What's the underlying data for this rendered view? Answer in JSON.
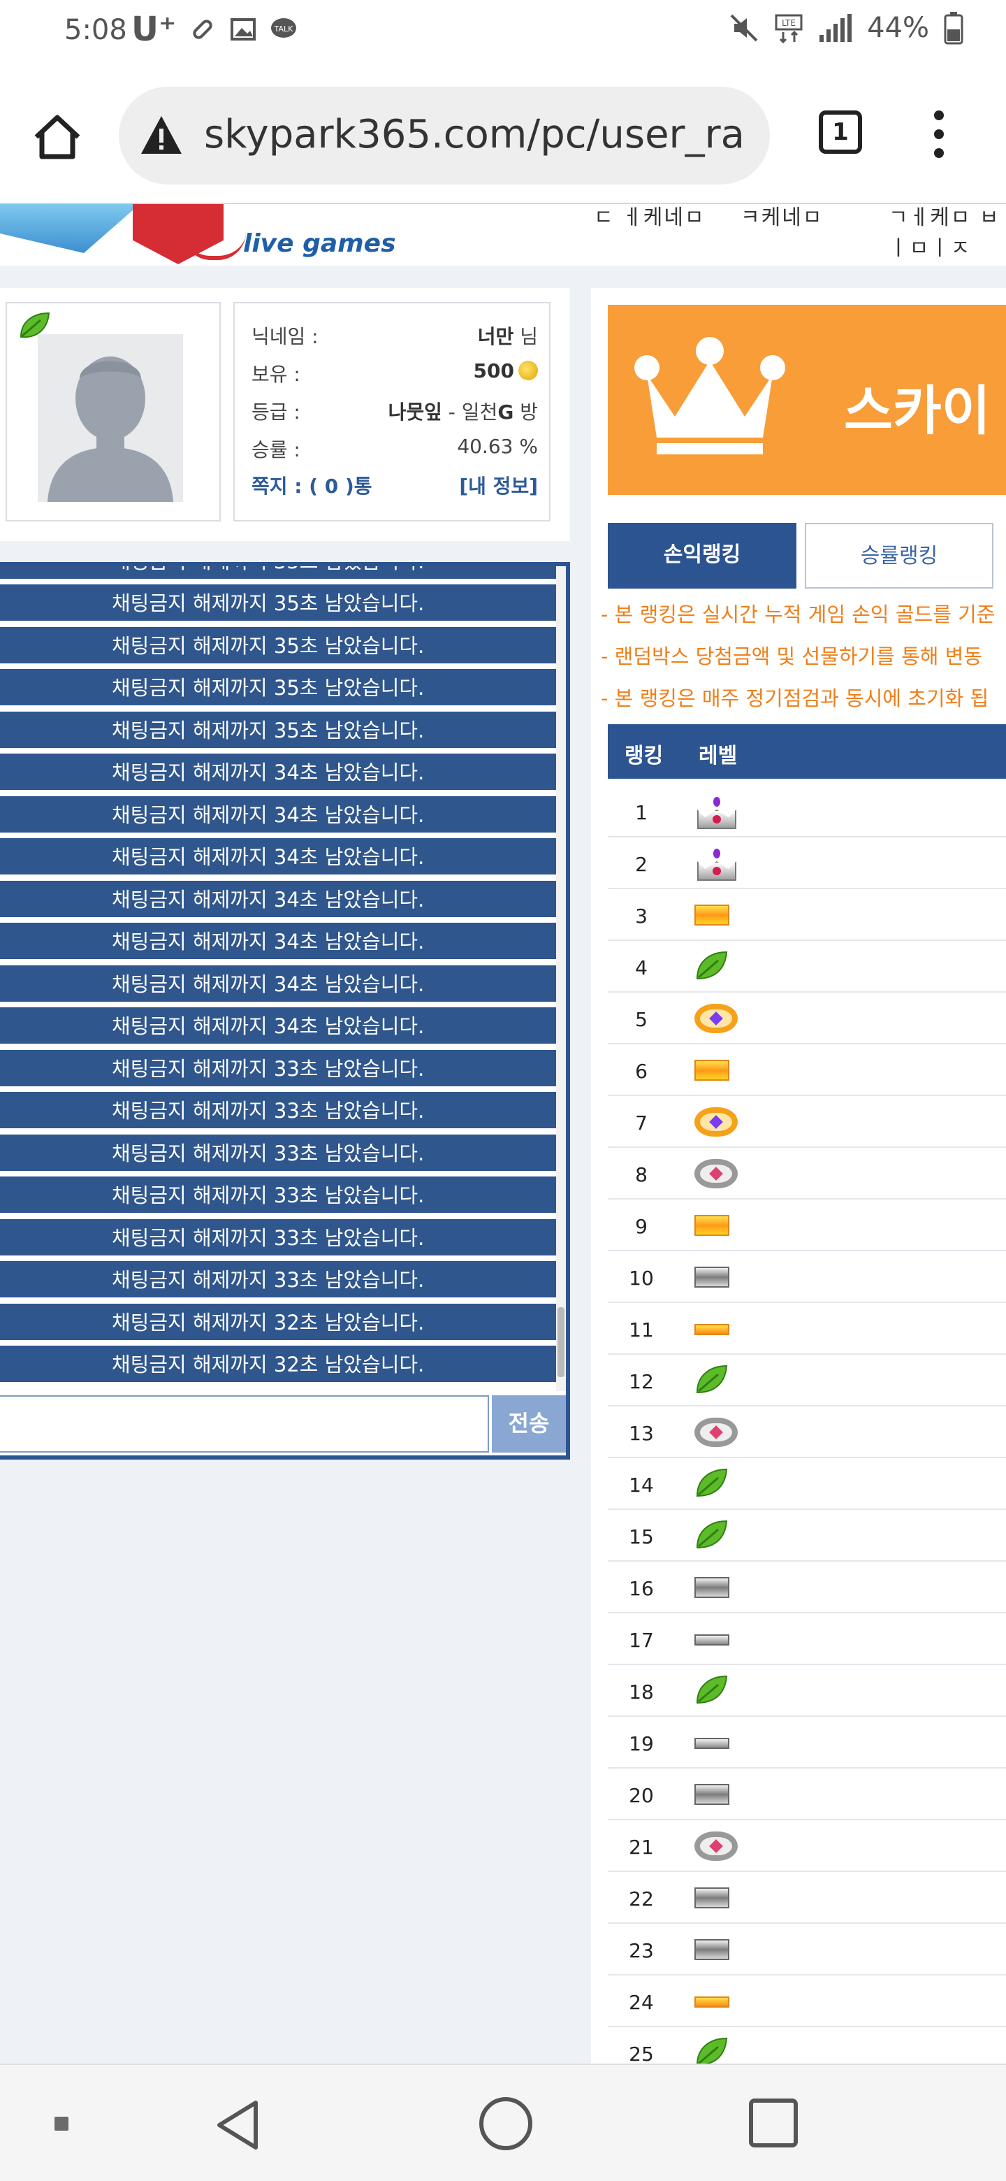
{
  "status_bar": {
    "time": "5:08",
    "carrier": "U⁺",
    "battery_pct": "44%",
    "icons": [
      "pill-icon",
      "image-icon",
      "talk-icon",
      "mute-icon",
      "lte-icon",
      "signal-icon",
      "battery-icon"
    ]
  },
  "browser": {
    "url": "skypark365.com/pc/user_ra",
    "tab_count": "1"
  },
  "header": {
    "logo_text": "live games",
    "nav_fragments": [
      "ㄷ ㅔ케네ㅁ",
      "ㅋ케네ㅁ",
      "ㄱㅔ케ㅁ ㅂㅣㅁㅣㅈ"
    ]
  },
  "user": {
    "nickname_label": "닉네임 :",
    "nickname_value": "너만",
    "nickname_suffix": "님",
    "holding_label": "보유 :",
    "holding_value": "500",
    "grade_label": "등급 :",
    "grade_value": "나뭇잎",
    "grade_extra_pre": " - 일천",
    "grade_extra_g": "G",
    "grade_extra_post": " 방",
    "winrate_label": "승률 :",
    "winrate_value": "40.63 %",
    "message_label": "쪽지 : ( 0 )통",
    "myinfo_label": "[내 정보]"
  },
  "chat": {
    "partial_message": "채팅금지 해제까지 35초 남았습니다.",
    "messages": [
      "채팅금지 해제까지 35초 남았습니다.",
      "채팅금지 해제까지 35초 남았습니다.",
      "채팅금지 해제까지 35초 남았습니다.",
      "채팅금지 해제까지 35초 남았습니다.",
      "채팅금지 해제까지 34초 남았습니다.",
      "채팅금지 해제까지 34초 남았습니다.",
      "채팅금지 해제까지 34초 남았습니다.",
      "채팅금지 해제까지 34초 남았습니다.",
      "채팅금지 해제까지 34초 남았습니다.",
      "채팅금지 해제까지 34초 남았습니다.",
      "채팅금지 해제까지 34초 남았습니다.",
      "채팅금지 해제까지 33초 남았습니다.",
      "채팅금지 해제까지 33초 남았습니다.",
      "채팅금지 해제까지 33초 남았습니다.",
      "채팅금지 해제까지 33초 남았습니다.",
      "채팅금지 해제까지 33초 남았습니다.",
      "채팅금지 해제까지 33초 남았습니다.",
      "채팅금지 해제까지 32초 남았습니다.",
      "채팅금지 해제까지 32초 남았습니다."
    ],
    "send_label": "전송",
    "input_value": ""
  },
  "ranking": {
    "banner_text": "스카이",
    "tab_profit": "손익랭킹",
    "tab_winrate": "승률랭킹",
    "notes": [
      "- 본 랭킹은 실시간 누적 게임 손익 골드를 기준",
      "- 랜덤박스 당첨금액 및 선물하기를 통해 변동",
      "- 본 랭킹은 매주 정기점검과 동시에 초기화 됩"
    ],
    "col_rank": "랭킹",
    "col_level": "레벨",
    "rows": [
      {
        "rank": "1",
        "level": "crown"
      },
      {
        "rank": "2",
        "level": "crown"
      },
      {
        "rank": "3",
        "level": "gold-bar"
      },
      {
        "rank": "4",
        "level": "leaf"
      },
      {
        "rank": "5",
        "level": "gold-ring"
      },
      {
        "rank": "6",
        "level": "gold-bar"
      },
      {
        "rank": "7",
        "level": "gold-ring"
      },
      {
        "rank": "8",
        "level": "silver-ring"
      },
      {
        "rank": "9",
        "level": "gold-bar"
      },
      {
        "rank": "10",
        "level": "silver-bar"
      },
      {
        "rank": "11",
        "level": "gold-thin-bar"
      },
      {
        "rank": "12",
        "level": "leaf"
      },
      {
        "rank": "13",
        "level": "silver-ring"
      },
      {
        "rank": "14",
        "level": "leaf"
      },
      {
        "rank": "15",
        "level": "leaf"
      },
      {
        "rank": "16",
        "level": "silver-bar"
      },
      {
        "rank": "17",
        "level": "silver-thin-bar"
      },
      {
        "rank": "18",
        "level": "leaf"
      },
      {
        "rank": "19",
        "level": "silver-thin-bar"
      },
      {
        "rank": "20",
        "level": "silver-bar"
      },
      {
        "rank": "21",
        "level": "silver-ring"
      },
      {
        "rank": "22",
        "level": "silver-bar"
      },
      {
        "rank": "23",
        "level": "silver-bar"
      },
      {
        "rank": "24",
        "level": "gold-thin-bar"
      },
      {
        "rank": "25",
        "level": "leaf"
      }
    ]
  },
  "colors": {
    "chat_blue": "#2f568d",
    "banner_orange": "#f89d38",
    "note_orange": "#f07f1a",
    "header_blue": "#2c5491"
  }
}
